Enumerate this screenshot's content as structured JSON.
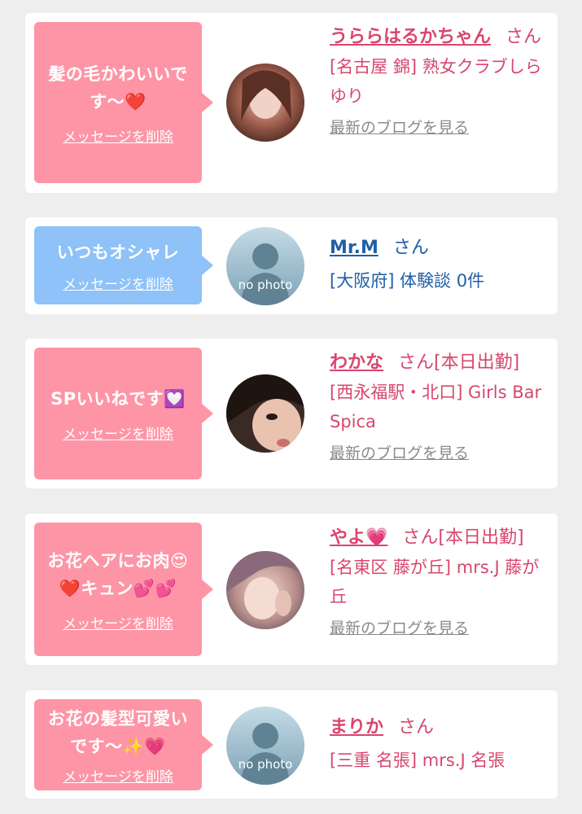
{
  "items": [
    {
      "message": "髪の毛かわいいです〜❤️",
      "delete_label": "メッセージを削除",
      "name": "うららはるかちゃん",
      "suffix": "さん",
      "shop": "[名古屋 錦] 熟女クラブしらゆり",
      "blog_label": "最新のブログを見る"
    },
    {
      "message": "いつもオシャレ",
      "delete_label": "メッセージを削除",
      "name": "Mr.M",
      "suffix": "さん",
      "shop": "[大阪府] 体験談 0件",
      "avatar_text": "no photo"
    },
    {
      "message": "SPいいねです💟",
      "delete_label": "メッセージを削除",
      "name": "わかな",
      "suffix": "さん[本日出勤]",
      "shop": "[西永福駅・北口] Girls Bar Spica",
      "blog_label": "最新のブログを見る"
    },
    {
      "message": "お花ヘアにお肉😍❤️キュン💕💕",
      "delete_label": "メッセージを削除",
      "name": "やよ💗",
      "suffix": "さん[本日出勤]",
      "shop": "[名東区 藤が丘] mrs.J 藤が丘",
      "blog_label": "最新のブログを見る"
    },
    {
      "message": "お花の髪型可愛いです〜✨💗",
      "delete_label": "メッセージを削除",
      "name": "まりか",
      "suffix": "さん",
      "shop": "[三重 名張] mrs.J 名張",
      "avatar_text": "no photo"
    }
  ],
  "colors": {
    "pink_bubble": "#fd95a6",
    "blue_bubble": "#8ec2f8",
    "name_pink": "#d8466e",
    "name_blue": "#1f5fa6",
    "blog_gray": "#8a8a8a"
  }
}
